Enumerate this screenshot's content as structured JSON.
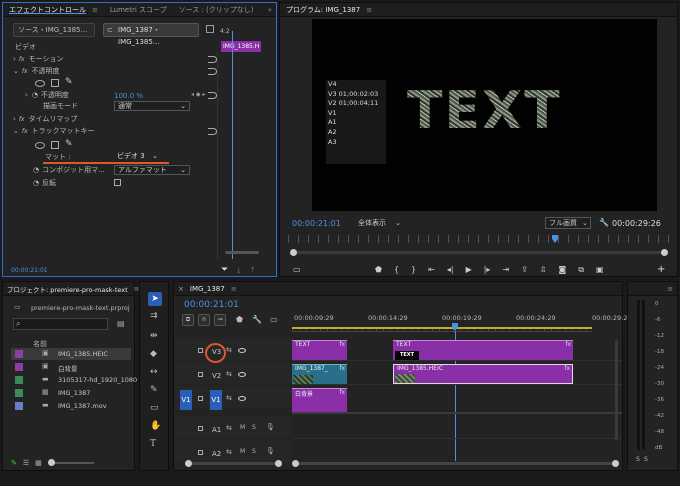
{
  "effects": {
    "tab_effect_controls": "エフェクトコントロール",
    "tab_lumetri": "Lumetri スコープ",
    "tab_source": "ソース : (クリップなし)",
    "source_btn": "ソース・IMG_1385...",
    "seq_btn": "IMG_1387・IMG_1385...",
    "ruler_time": "4:2",
    "clip_label": "IMG_1385.H",
    "section_video": "ビデオ",
    "motion": "モーション",
    "opacity": "不透明度",
    "opacity_param": "不透明度",
    "opacity_value": "100.0 %",
    "blend_mode_label": "描画モード",
    "blend_mode_value": "通常",
    "time_remap": "タイムリマップ",
    "track_matte": "トラックマットキー",
    "matte_label": "マット :",
    "matte_value": "ビデオ 3",
    "composite_label": "コンポジット用マ...",
    "composite_value": "アルファマット",
    "reverse_label": "反転",
    "timecode": "00:00:21:01"
  },
  "program": {
    "title": "プログラム: IMG_1387",
    "tracks_overlay": [
      "V4",
      "V3 01;00:02:03",
      "V2 01;00:04;11",
      "V1",
      "A1",
      "A2",
      "A3"
    ],
    "overlay_text": "TEXT",
    "timecode": "00:00:21:01",
    "fit_label": "全体表示",
    "quality_label": "フル画質",
    "duration": "00:00:29:26"
  },
  "project": {
    "title": "プロジェクト: premiere-pro-mask-text",
    "file": "premiere-pro-mask-text.prproj",
    "col_name": "名前",
    "items": [
      {
        "name": "IMG_1385.HEIC",
        "color": "#8a3fa8"
      },
      {
        "name": "白背景",
        "color": "#8a3fa8"
      },
      {
        "name": "3105317-hd_1920_1080",
        "color": "#3a8a5a"
      },
      {
        "name": "IMG_1387",
        "color": "#3a8a5a"
      },
      {
        "name": "IMG_1387.mov",
        "color": "#6a7cc8"
      }
    ]
  },
  "timeline": {
    "tab": "IMG_1387",
    "timecode": "00:00:21:01",
    "ruler": [
      "00:00:09:29",
      "00:00:14:29",
      "00:00:19:29",
      "00:00:24:29",
      "00:00:29:29"
    ],
    "tracks": {
      "v3": "V3",
      "v2": "V2",
      "v1": "V1",
      "a1": "A1",
      "a2": "A2",
      "src_v1": "V1"
    },
    "clips": {
      "text1": "TEXT",
      "text2": "TEXT",
      "img_short": "IMG_1387_",
      "img_long": "IMG_1385.HEIC",
      "white_bg": "白背景",
      "text_thumb": "TEXT",
      "fx": "fx"
    },
    "audio_m": "M",
    "audio_s": "S"
  },
  "meter": {
    "labels": [
      "0",
      "-6",
      "-12",
      "-18",
      "-24",
      "-30",
      "-36",
      "-42",
      "-48",
      "dB"
    ],
    "solo": [
      "S",
      "S"
    ]
  },
  "accent_colors": {
    "clip_purple": "#8a2fa8",
    "playhead_blue": "#4d8fe6",
    "highlight_circle": "#e0572d"
  }
}
